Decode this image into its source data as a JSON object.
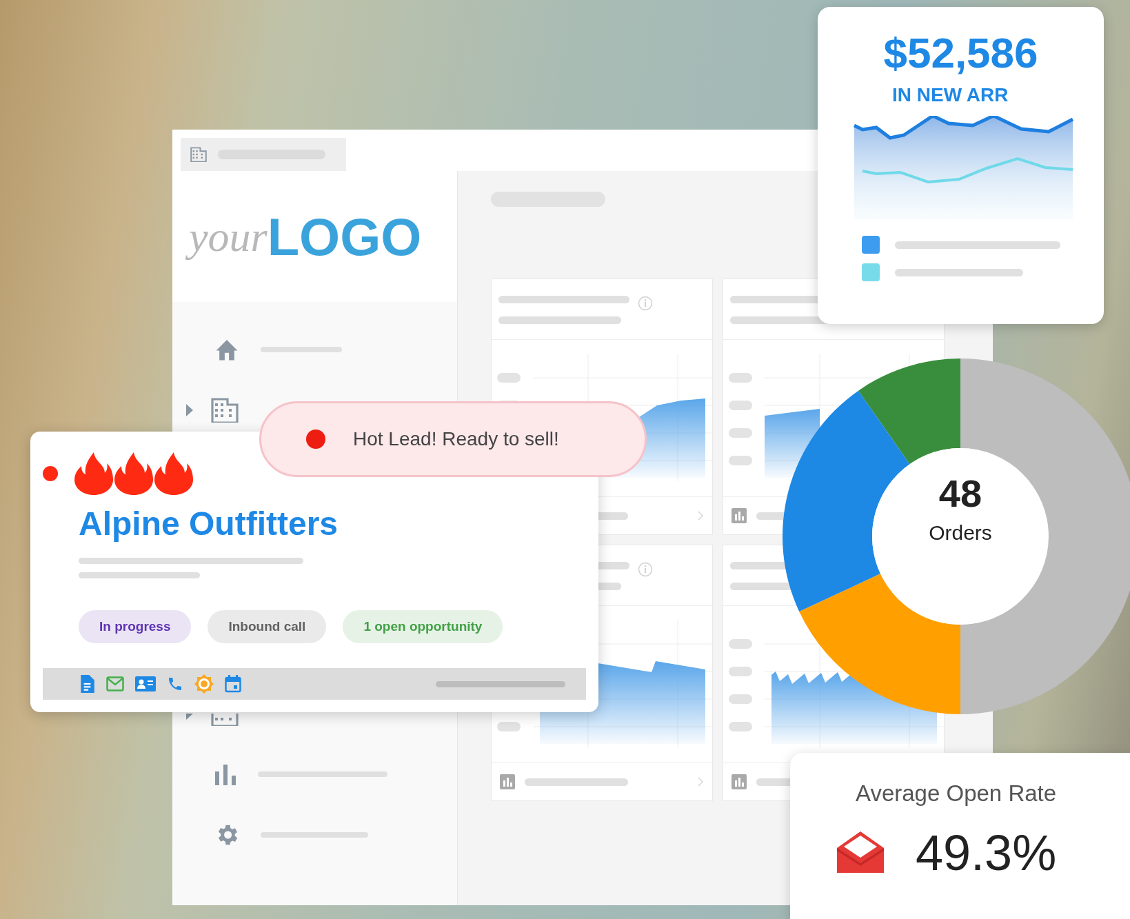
{
  "logo": {
    "part_1": "your",
    "part_2": "LOGO"
  },
  "toast": {
    "text": "Hot Lead! Ready to sell!"
  },
  "lead_card": {
    "stars": 3,
    "name": "Alpine Outfitters",
    "tags": [
      {
        "label": "In progress",
        "color": "#5e35b1"
      },
      {
        "label": "Inbound call",
        "color": "#616161"
      },
      {
        "label": "1 open opportunity",
        "color": "#43a047"
      }
    ]
  },
  "arr_card": {
    "value": "$52,586",
    "caption": "IN NEW ARR"
  },
  "orders": {
    "value": "48",
    "label": "Orders"
  },
  "open_rate": {
    "title": "Average Open Rate",
    "value": "49.3%"
  }
}
